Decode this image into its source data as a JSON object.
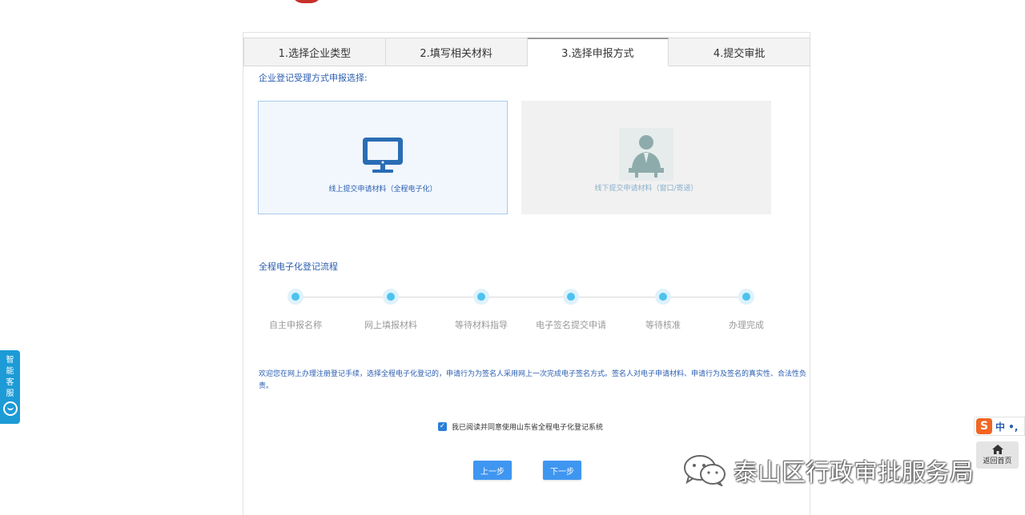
{
  "tabs": [
    {
      "label": "1.选择企业类型",
      "active": false
    },
    {
      "label": "2.填写相关材料",
      "active": false
    },
    {
      "label": "3.选择申报方式",
      "active": true
    },
    {
      "label": "4.提交审批",
      "active": false
    }
  ],
  "method": {
    "section_label": "企业登记受理方式申报选择:",
    "online_label": "线上提交申请材料（全程电子化）",
    "offline_label": "线下提交申请材料（窗口/寄递）",
    "online_icon": "computer-monitor-icon",
    "offline_icon": "clerk-at-desk-icon"
  },
  "process": {
    "title": "全程电子化登记流程",
    "steps": [
      "自主申报名称",
      "网上填报材料",
      "等待材料指导",
      "电子签名提交申请",
      "等待核准",
      "办理完成"
    ]
  },
  "notice": "欢迎您在网上办理注册登记手续，选择全程电子化登记的，申请行为为签名人采用网上一次完成电子签名方式。签名人对电子申请材料、申请行为及签名的真实性、合法性负责。",
  "agreement": {
    "checked": true,
    "label": "我已阅读并同意使用山东省全程电子化登记系统"
  },
  "buttons": {
    "prev": "上一步",
    "next": "下一步"
  },
  "side": {
    "customer_service": [
      "智",
      "能",
      "客",
      "服"
    ],
    "home_label": "返回首页",
    "ime_logo": "S",
    "ime_text": "中 •,"
  },
  "watermark": "泰山区行政审批服务局",
  "colors": {
    "accent": "#3f96f0",
    "link_blue": "#2a5db0",
    "step_dot": "#4cc3ee",
    "service_tab": "#1c9bd6"
  }
}
